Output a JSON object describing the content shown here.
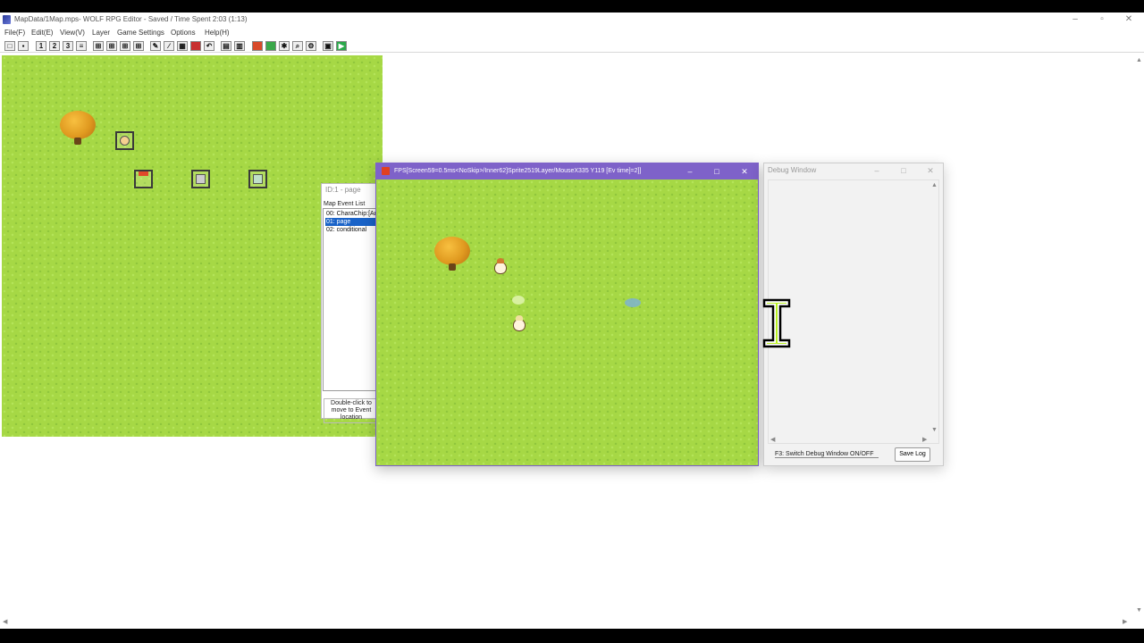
{
  "app": {
    "title": "MapData/1Map.mps- WOLF RPG Editor - Saved / Time Spent 2:03 (1:13)"
  },
  "menu": {
    "items": [
      "File(F)",
      "Edit(E)",
      "View(V)",
      "Layer",
      "Game Settings",
      "Options",
      "Help(H)"
    ]
  },
  "toolbar": {
    "layer_labels": [
      "1",
      "2",
      "3"
    ]
  },
  "event_panel": {
    "title": "ID:1 - page",
    "list_label": "Map Event List",
    "items": [
      "00: CharaChip:[Ar",
      "01: page",
      "02: conditional"
    ],
    "selected_index": 1,
    "hint": "Double-click to move to Event location"
  },
  "game_window": {
    "title": "FPS[Screen59=0.5ms<NoSkip>/Inner62]Sprite2519Layer/MouseX335 Y119 [Ev time]=2]]"
  },
  "debug_window": {
    "title": "Debug Window",
    "hint": "F3: Switch Debug Window ON/OFF",
    "save_button": "Save Log"
  },
  "colors": {
    "grass": "#a6d845",
    "game_titlebar": "#7e62c9",
    "selection": "#1a63c8"
  }
}
